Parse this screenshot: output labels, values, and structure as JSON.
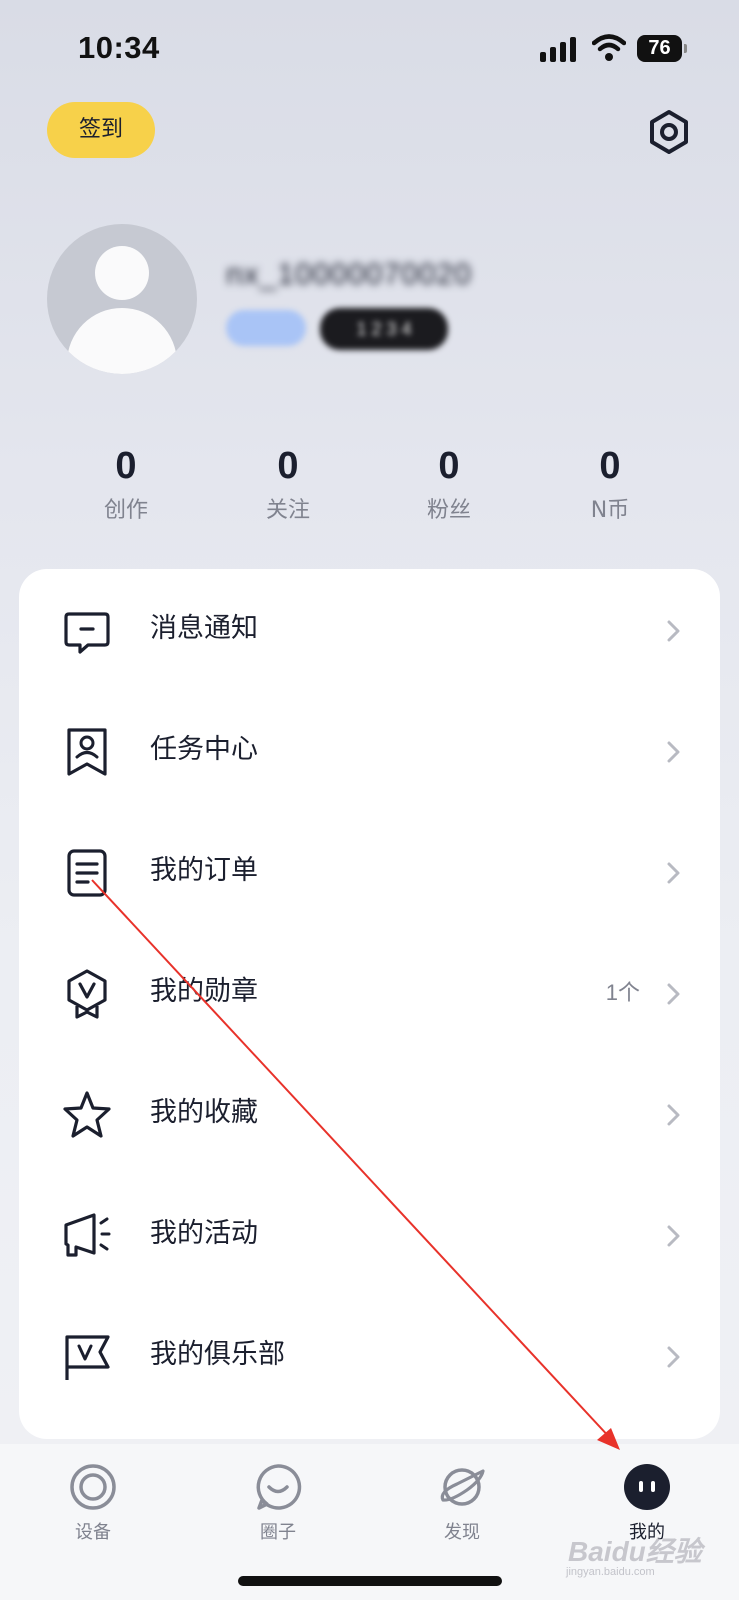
{
  "status_bar": {
    "time": "10:34",
    "battery": "76"
  },
  "header": {
    "checkin_label": "签到"
  },
  "profile": {
    "username": "nx_10000070020",
    "id_badge": "1 2 3 4"
  },
  "stats": [
    {
      "value": "0",
      "label": "创作"
    },
    {
      "value": "0",
      "label": "关注"
    },
    {
      "value": "0",
      "label": "粉丝"
    },
    {
      "value": "0",
      "label": "N币"
    }
  ],
  "menu": [
    {
      "label": "消息通知",
      "icon": "message-icon",
      "value": ""
    },
    {
      "label": "任务中心",
      "icon": "task-icon",
      "value": ""
    },
    {
      "label": "我的订单",
      "icon": "order-icon",
      "value": ""
    },
    {
      "label": "我的勋章",
      "icon": "medal-icon",
      "value": "1个"
    },
    {
      "label": "我的收藏",
      "icon": "star-icon",
      "value": ""
    },
    {
      "label": "我的活动",
      "icon": "megaphone-icon",
      "value": ""
    },
    {
      "label": "我的俱乐部",
      "icon": "club-flag-icon",
      "value": ""
    }
  ],
  "nav": [
    {
      "label": "设备",
      "icon": "device-icon",
      "active": false
    },
    {
      "label": "圈子",
      "icon": "circle-chat-icon",
      "active": false
    },
    {
      "label": "发现",
      "icon": "planet-icon",
      "active": false
    },
    {
      "label": "我的",
      "icon": "profile-icon",
      "active": true
    }
  ],
  "watermark": {
    "text": "Baidu经验",
    "sub": "jingyan.baidu.com"
  },
  "colors": {
    "accent_yellow": "#f7d14a",
    "text_dark": "#1b1f2e",
    "text_muted": "#80838f",
    "annotation_red": "#e8322a"
  }
}
